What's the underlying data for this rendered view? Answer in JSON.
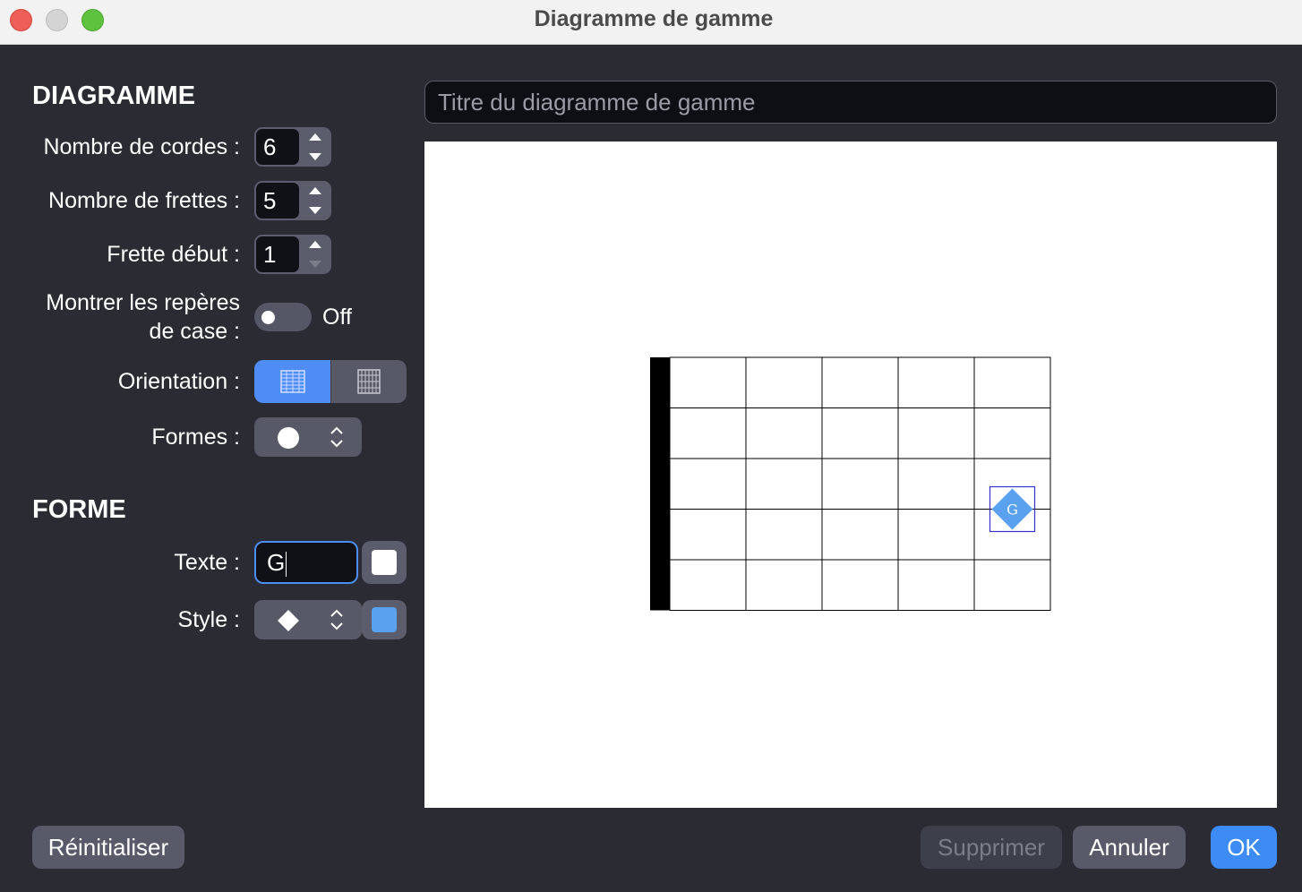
{
  "window": {
    "title": "Diagramme de gamme"
  },
  "diagram_section": {
    "heading": "DIAGRAMME",
    "strings_label": "Nombre de cordes :",
    "strings_value": "6",
    "frets_label": "Nombre de frettes :",
    "frets_value": "5",
    "start_fret_label": "Frette début :",
    "start_fret_value": "1",
    "markers_label_line1": "Montrer les repères",
    "markers_label_line2": "de case :",
    "markers_state": "Off",
    "orientation_label": "Orientation :",
    "orientation_options": [
      "horizontal-grid-icon",
      "vertical-grid-icon"
    ],
    "orientation_selected": 0,
    "shapes_label": "Formes :",
    "shapes_selected": "circle"
  },
  "shape_section": {
    "heading": "FORME",
    "text_label": "Texte :",
    "text_value": "G",
    "text_color": "#ffffff",
    "style_label": "Style :",
    "style_selected": "diamond",
    "style_color": "#5aa2f0"
  },
  "diagram_title": {
    "placeholder": "Titre du diagramme de gamme",
    "value": ""
  },
  "fretboard": {
    "strings": 6,
    "frets": 5,
    "start_fret": 1,
    "marks": [
      {
        "string": 3,
        "fret": 5,
        "text": "G",
        "shape": "diamond",
        "fill": "#5aa2f0",
        "text_color": "#ffffff",
        "selected": true
      }
    ]
  },
  "buttons": {
    "reset": "Réinitialiser",
    "delete": "Supprimer",
    "cancel": "Annuler",
    "ok": "OK"
  }
}
